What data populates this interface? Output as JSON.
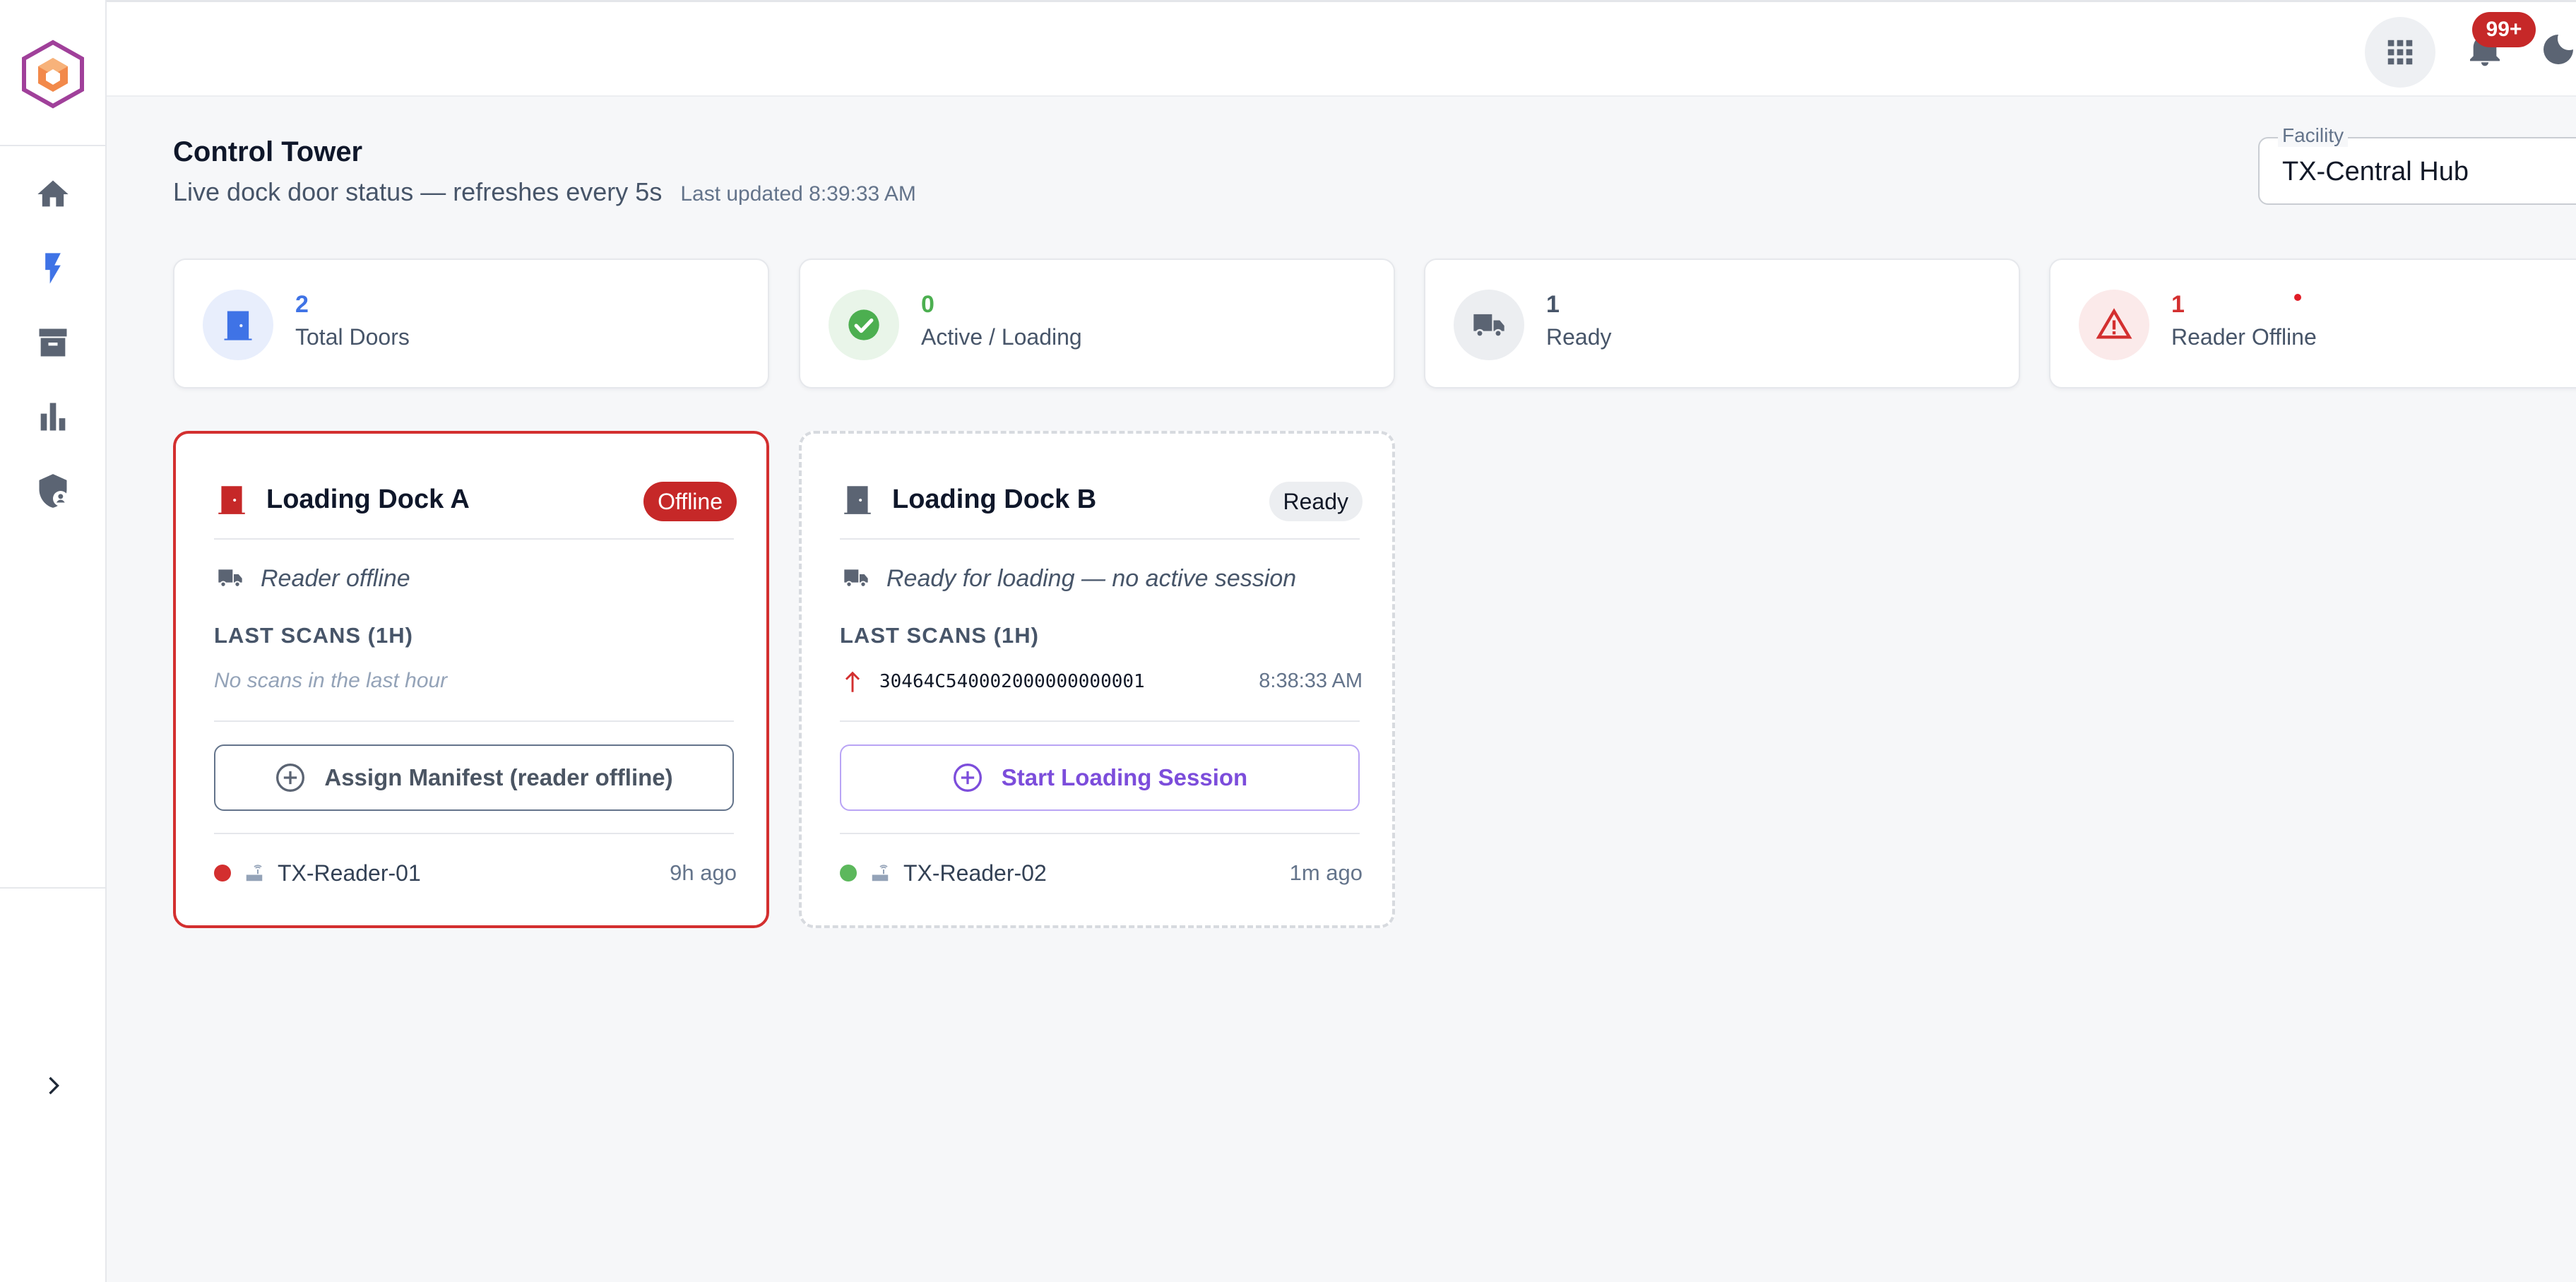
{
  "colors": {
    "accent_blue": "#3f73e6",
    "success_green": "#4caf50",
    "danger_red": "#c62828",
    "muted_grey": "#64748b",
    "purple": "#7c4ddb"
  },
  "icons": {
    "sidebar": [
      "home-icon",
      "lightning-icon",
      "archive-icon",
      "bar-chart-icon",
      "shield-user-icon"
    ],
    "topbar": [
      "apps-grid-icon",
      "bell-icon",
      "moon-icon"
    ]
  },
  "topbar": {
    "notifications_badge": "99+"
  },
  "header": {
    "title": "Control Tower",
    "subtitle": "Live dock door status — refreshes every 5s",
    "last_updated": "Last updated 8:39:33 AM"
  },
  "facility": {
    "label": "Facility",
    "value": "TX-Central Hub"
  },
  "stats": [
    {
      "value": "2",
      "label": "Total Doors",
      "icon": "door-icon",
      "color": "#3f73e6"
    },
    {
      "value": "0",
      "label": "Active / Loading",
      "icon": "check-circle-icon",
      "color": "#4caf50"
    },
    {
      "value": "1",
      "label": "Ready",
      "icon": "truck-icon",
      "color": "#475569"
    },
    {
      "value": "1",
      "label": "Reader Offline",
      "icon": "warning-icon",
      "color": "#d32f2f"
    }
  ],
  "docks": [
    {
      "title": "Loading Dock A",
      "status": "Offline",
      "status_line": "Reader offline",
      "scans_heading": "LAST SCANS (1H)",
      "scans_empty": "No scans in the last hour",
      "button": "Assign Manifest (reader offline)",
      "reader_name": "TX-Reader-01",
      "reader_ago": "9h ago",
      "reader_online": false
    },
    {
      "title": "Loading Dock B",
      "status": "Ready",
      "status_line": "Ready for loading — no active session",
      "scans_heading": "LAST SCANS (1H)",
      "scans": [
        {
          "epc": "30464C540002000000000001",
          "time": "8:38:33 AM"
        }
      ],
      "button": "Start Loading Session",
      "reader_name": "TX-Reader-02",
      "reader_ago": "1m ago",
      "reader_online": true
    }
  ]
}
